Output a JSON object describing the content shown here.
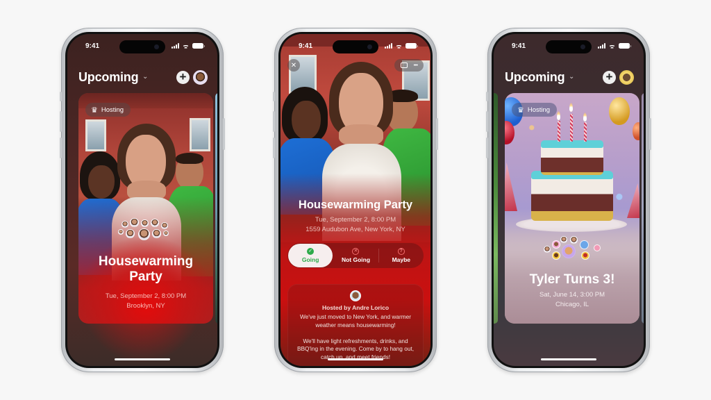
{
  "phones": [
    {
      "status": {
        "time": "9:41"
      },
      "header": {
        "title": "Upcoming",
        "chevron": "⌄",
        "add_icon": "plus-icon",
        "avatar": "memoji-avatar"
      },
      "card": {
        "badge": {
          "icon": "crown-icon",
          "label": "Hosting"
        },
        "title_line1": "Housewarming",
        "title_line2": "Party",
        "datetime": "Tue, September 2, 8:00 PM",
        "location": "Brooklyn, NY",
        "guest_avatars": 11
      }
    },
    {
      "status": {
        "time": "9:41"
      },
      "controls": {
        "close_icon": "close-icon",
        "edit_icon": "photo-edit-icon",
        "more_icon": "more-icon"
      },
      "event": {
        "title": "Housewarming Party",
        "datetime": "Tue, September 2, 8:00 PM",
        "address": "1559 Audubon Ave, New York, NY"
      },
      "rsvp": {
        "options": [
          {
            "label": "Going",
            "icon": "checkmark-icon",
            "selected": true
          },
          {
            "label": "Not Going",
            "icon": "xmark-icon",
            "selected": false
          },
          {
            "label": "Maybe",
            "icon": "question-icon",
            "selected": false
          }
        ]
      },
      "description": {
        "host": "Hosted by Andre Lorico",
        "paragraph1": "We've just moved to New York, and warmer weather means housewarming!",
        "paragraph2": "We'll have light refreshments, drinks, and BBQ'ing in the evening. Come by to hang out, catch up, and meet friends!"
      }
    },
    {
      "status": {
        "time": "9:41"
      },
      "header": {
        "title": "Upcoming",
        "chevron": "⌄",
        "add_icon": "plus-icon",
        "avatar": "memoji-avatar"
      },
      "card": {
        "badge": {
          "icon": "crown-icon",
          "label": "Hosting"
        },
        "title": "Tyler Turns 3!",
        "datetime": "Sat, June 14, 3:00 PM",
        "location": "Chicago, IL",
        "guest_avatars": 10
      }
    }
  ],
  "icons": {
    "plus": "+",
    "crown": "♛",
    "close": "✕",
    "check": "✓",
    "xmark": "✕",
    "question": "?",
    "more": "•••"
  },
  "colors": {
    "going_green": "#2eaa4a",
    "party_red": "#d81414",
    "background": "#f7f7f7"
  }
}
